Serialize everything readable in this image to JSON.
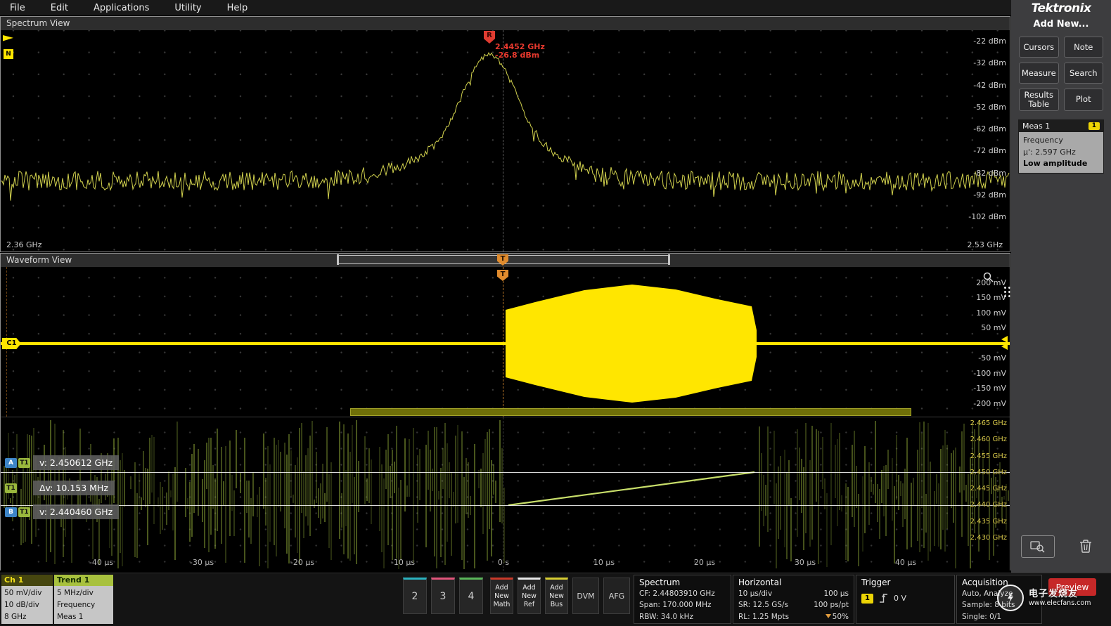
{
  "menu": {
    "items": [
      "File",
      "Edit",
      "Applications",
      "Utility",
      "Help"
    ]
  },
  "brand": {
    "logo": "Tektronix"
  },
  "sidebar": {
    "add_new_label": "Add New...",
    "buttons": [
      "Cursors",
      "Note",
      "Measure",
      "Search",
      "Results Table",
      "Plot"
    ],
    "meas": {
      "title": "Meas 1",
      "badge": "1",
      "lines": [
        "Frequency",
        "μ': 2.597 GHz",
        "Low amplitude"
      ]
    }
  },
  "spectrum": {
    "title": "Spectrum View",
    "marker": {
      "label": "R",
      "freq": "2.4452 GHz",
      "ampl": "-26.8 dBm"
    },
    "left_badge": "N",
    "y_labels": [
      "-22 dBm",
      "-32 dBm",
      "-42 dBm",
      "-52 dBm",
      "-62 dBm",
      "-72 dBm",
      "-82 dBm",
      "-92 dBm",
      "-102 dBm"
    ],
    "x_left": "2.36 GHz",
    "x_right": "2.53 GHz"
  },
  "waveform": {
    "title": "Waveform View",
    "channel_badge": "C1",
    "trigger_marker": "T",
    "y_pos": [
      "200 mV",
      "150 mV",
      "100 mV",
      "50 mV"
    ],
    "y_neg": [
      "-50 mV",
      "-100 mV",
      "-150 mV",
      "-200 mV"
    ]
  },
  "trend": {
    "freq_labels": [
      "2.465 GHz",
      "2.460 GHz",
      "2.455 GHz",
      "2.450 GHz",
      "2.445 GHz",
      "2.440 GHz",
      "2.435 GHz",
      "2.430 GHz"
    ],
    "time_labels": [
      "-40 μs",
      "-30 μs",
      "-20 μs",
      "-10 μs",
      "0 s",
      "10 μs",
      "20 μs",
      "30 μs",
      "40 μs"
    ],
    "cursors": {
      "a_label": "A",
      "b_label": "B",
      "t_label": "T1",
      "a_value": "v: 2.450612 GHz",
      "delta": "Δv: 10.153 MHz",
      "b_value": "v: 2.440460 GHz"
    }
  },
  "bottom_bar": {
    "ch1": {
      "title": "Ch 1",
      "lines": [
        "50 mV/div",
        "10 dB/div",
        "8 GHz"
      ]
    },
    "trend1": {
      "title": "Trend 1",
      "lines": [
        "5 MHz/div",
        "Frequency",
        "Meas 1"
      ]
    },
    "channel_buttons": [
      {
        "label": "2",
        "color": "#2bb3c0"
      },
      {
        "label": "3",
        "color": "#e2567c"
      },
      {
        "label": "4",
        "color": "#5bb75b"
      }
    ],
    "add_buttons": [
      {
        "label": "Add New Math",
        "color": "#cb3a2a"
      },
      {
        "label": "Add New Ref",
        "color": "#e8e8e8"
      },
      {
        "label": "Add New Bus",
        "color": "#d8ce32"
      }
    ],
    "tools": [
      "DVM",
      "AFG"
    ],
    "spectrum_box": {
      "title": "Spectrum",
      "lines": [
        "CF: 2.44803910 GHz",
        "Span: 170.000 MHz",
        "RBW: 34.0 kHz"
      ]
    },
    "horizontal_box": {
      "title": "Horizontal",
      "rows": [
        [
          "10 μs/div",
          "100 μs"
        ],
        [
          "SR: 12.5 GS/s",
          "100 ps/pt"
        ],
        [
          "RL: 1.25 Mpts",
          "50%"
        ]
      ]
    },
    "trigger_box": {
      "title": "Trigger",
      "source": "1",
      "value": "0 V"
    },
    "acquisition_box": {
      "title": "Acquisition",
      "lines": [
        "Auto,  Analyze",
        "Sample: 8 bits",
        "Single: 0/1"
      ]
    },
    "preview": "Preview"
  },
  "watermark": {
    "line1": "电子发烧友",
    "line2": "www.elecfans.com"
  },
  "colors": {
    "trace_yellow": "#ffe600",
    "spectrum_trace": "#d2d24e",
    "trend_green": "#9fbc3e",
    "marker_red": "#e03c31",
    "trigger_orange": "#e08b2d"
  }
}
